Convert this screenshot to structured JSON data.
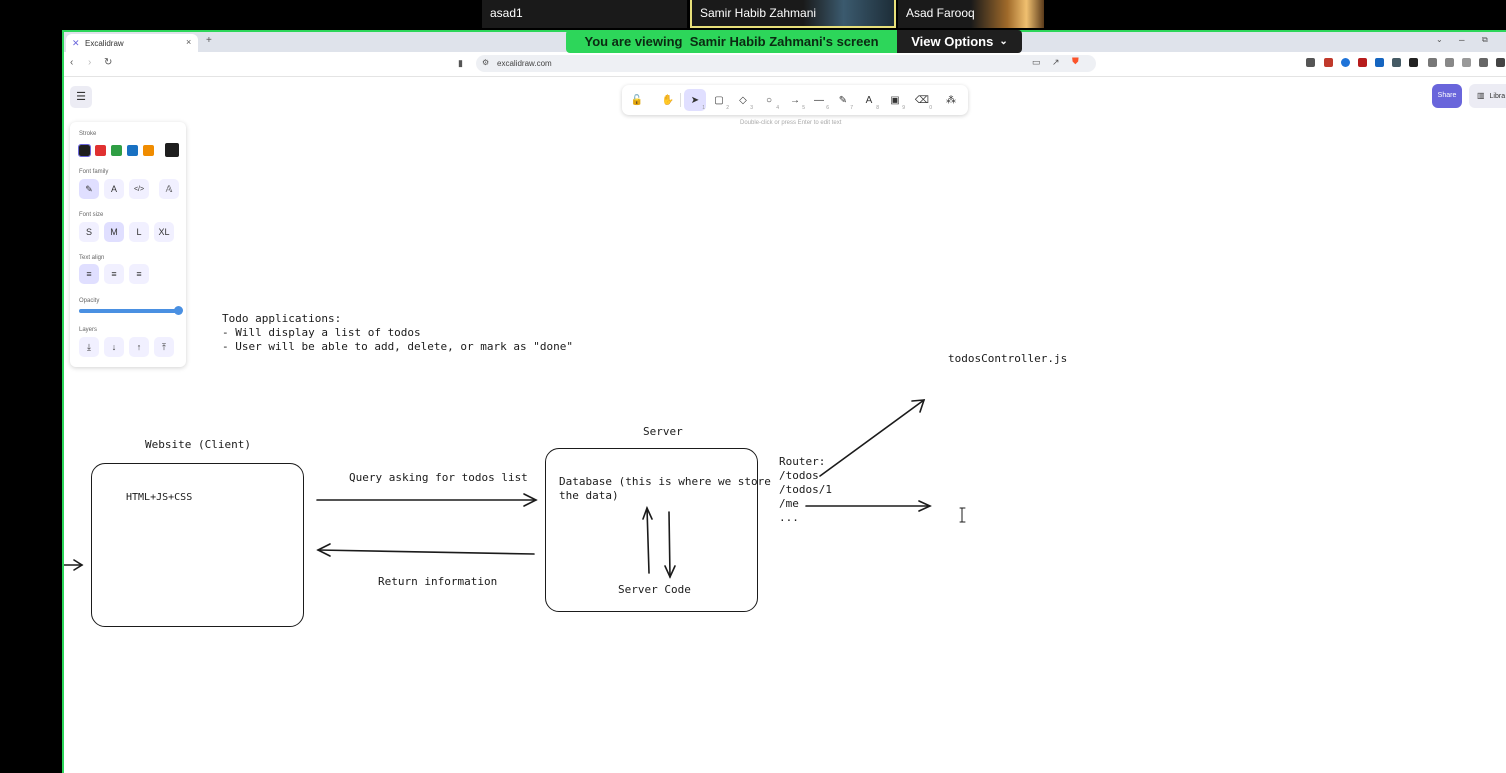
{
  "zoom": {
    "participants": [
      {
        "name": "asad1"
      },
      {
        "name": "Samir Habib Zahmani"
      },
      {
        "name": "Asad Farooq"
      }
    ],
    "share_banner": {
      "prefix": "You are viewing",
      "presenter": "Samir Habib Zahmani's screen",
      "options_label": "View Options"
    }
  },
  "browser": {
    "tab_title": "Excalidraw",
    "url": "excalidraw.com"
  },
  "excalidraw": {
    "hint": "Double-click or press Enter to edit text",
    "share_label": "Share",
    "library_label": "Libra",
    "tools": [
      {
        "name": "lock",
        "glyph": "🔓",
        "key": ""
      },
      {
        "name": "hand",
        "glyph": "✋",
        "key": ""
      },
      {
        "name": "selection",
        "glyph": "➤",
        "key": "1"
      },
      {
        "name": "rectangle",
        "glyph": "▢",
        "key": "2"
      },
      {
        "name": "diamond",
        "glyph": "◇",
        "key": "3"
      },
      {
        "name": "ellipse",
        "glyph": "○",
        "key": "4"
      },
      {
        "name": "arrow",
        "glyph": "→",
        "key": "5"
      },
      {
        "name": "line",
        "glyph": "—",
        "key": "6"
      },
      {
        "name": "draw",
        "glyph": "✎",
        "key": "7"
      },
      {
        "name": "text",
        "glyph": "A",
        "key": "8"
      },
      {
        "name": "image",
        "glyph": "▣",
        "key": "9"
      },
      {
        "name": "eraser",
        "glyph": "⌫",
        "key": "0"
      },
      {
        "name": "more-tools",
        "glyph": "⁂",
        "key": ""
      }
    ],
    "properties": {
      "stroke_label": "Stroke",
      "stroke_colors": [
        "#1e1e1e",
        "#e03131",
        "#2f9e44",
        "#1971c2",
        "#f08c00"
      ],
      "stroke_current": "#1e1e1e",
      "font_family_label": "Font family",
      "font_family_options": [
        "✎",
        "A",
        "</>",
        "𝔸"
      ],
      "font_size_label": "Font size",
      "font_size_options": [
        "S",
        "M",
        "L",
        "XL"
      ],
      "text_align_label": "Text align",
      "text_align_options": [
        "≡",
        "≡",
        "≡"
      ],
      "opacity_label": "Opacity",
      "opacity_value": 100,
      "layers_label": "Layers",
      "layers_options": [
        "⤓",
        "↓",
        "↑",
        "⤒"
      ]
    }
  },
  "canvas": {
    "notes": [
      "Todo applications:",
      "- Will display a list of todos",
      "- User will be able to add, delete, or mark as \"done\""
    ],
    "client_label": "Website (Client)",
    "client_content": "HTML+JS+CSS",
    "server_label": "Server",
    "server_db_text": [
      "Database (this is where we store",
      "the data)"
    ],
    "server_code": "Server Code",
    "query_label": "Query asking for todos list",
    "return_label": "Return information",
    "router_lines": [
      "Router:",
      "/todos",
      "/todos/1",
      "/me",
      "..."
    ],
    "controller_label": "todosController.js"
  }
}
